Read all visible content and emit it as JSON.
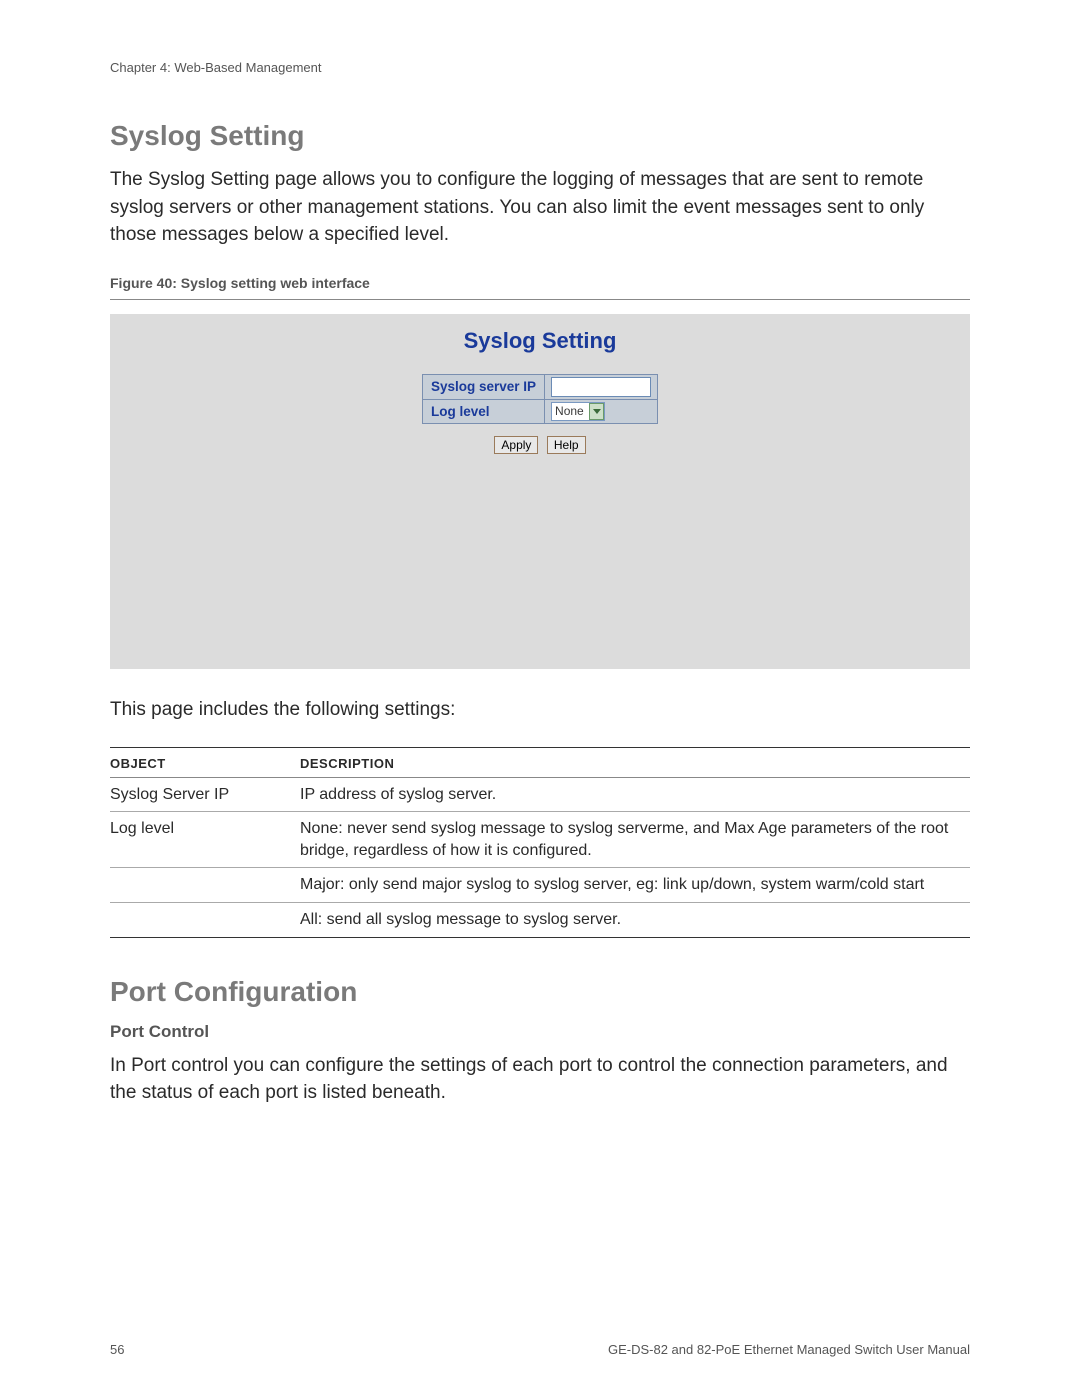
{
  "chapter": "Chapter 4: Web-Based Management",
  "section1": {
    "title": "Syslog Setting",
    "intro": "The Syslog Setting page allows you to configure the logging of messages that are sent to remote syslog servers or other management stations. You can also limit the event messages sent to only those messages below a specified level.",
    "figure_caption": "Figure 40: Syslog setting web interface",
    "interface": {
      "title": "Syslog Setting",
      "rows": {
        "ip_label": "Syslog server IP",
        "ip_value": "",
        "level_label": "Log level",
        "level_value": "None"
      },
      "buttons": {
        "apply": "Apply",
        "help": "Help"
      }
    },
    "lead": "This page includes the following settings:",
    "table": {
      "headers": {
        "object": "OBJECT",
        "description": "DESCRIPTION"
      },
      "rows": [
        {
          "object": "Syslog Server IP",
          "description": "IP address of syslog server."
        },
        {
          "object": "Log level",
          "description": "None: never send syslog message to syslog serverme, and Max Age parameters of the root bridge, regardless of how it is configured."
        },
        {
          "object": "",
          "description": "Major: only send major syslog to syslog server, eg: link up/down, system warm/cold start"
        },
        {
          "object": "",
          "description": "All: send all syslog message to syslog server."
        }
      ]
    }
  },
  "section2": {
    "title": "Port Configuration",
    "subsection": "Port Control",
    "intro": "In Port control you can configure the settings of each port to control the connection parameters, and the status of each port is listed beneath."
  },
  "footer": {
    "page": "56",
    "manual": "GE-DS-82 and 82-PoE Ethernet Managed Switch User Manual"
  }
}
